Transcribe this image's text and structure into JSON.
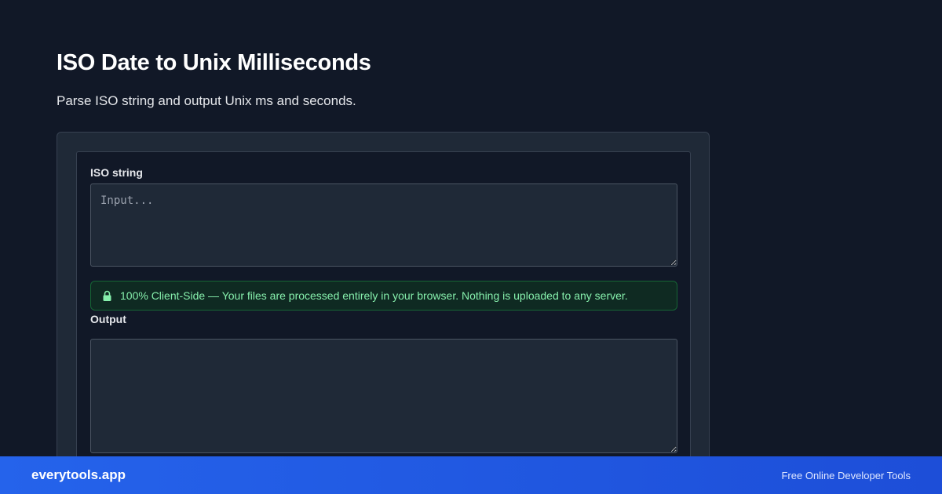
{
  "header": {
    "title": "ISO Date to Unix Milliseconds",
    "subtitle": "Parse ISO string and output Unix ms and seconds."
  },
  "form": {
    "input_label": "ISO string",
    "input_placeholder": "Input...",
    "input_value": "",
    "notice_icon": "lock-icon",
    "notice_text": "100% Client-Side — Your files are processed entirely in your browser. Nothing is uploaded to any server.",
    "output_label": "Output",
    "output_value": ""
  },
  "footer": {
    "brand": "everytools.app",
    "tagline": "Free Online Developer Tools"
  },
  "colors": {
    "background": "#111827",
    "card": "#1f2937",
    "notice_text": "#86efac",
    "footer": "#2563eb"
  }
}
